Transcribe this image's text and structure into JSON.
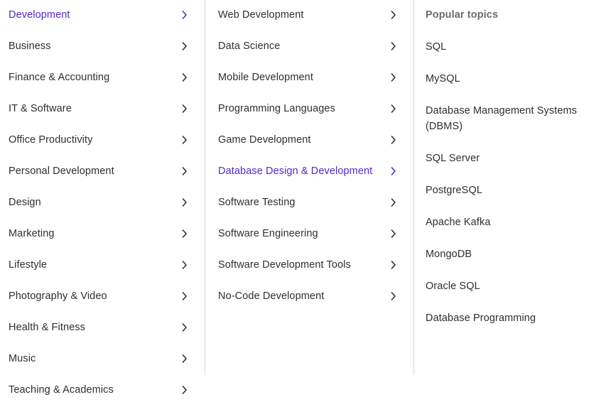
{
  "colors": {
    "accent": "#5624d0",
    "text": "#2d2f31",
    "muted": "#6a6f73",
    "divider": "#d1d7dc",
    "background": "#ffffff"
  },
  "categories": {
    "items": [
      {
        "label": "Development",
        "active": true,
        "chevron": "chevron-right-icon"
      },
      {
        "label": "Business",
        "active": false,
        "chevron": "chevron-right-icon"
      },
      {
        "label": "Finance & Accounting",
        "active": false,
        "chevron": "chevron-right-icon"
      },
      {
        "label": "IT & Software",
        "active": false,
        "chevron": "chevron-right-icon"
      },
      {
        "label": "Office Productivity",
        "active": false,
        "chevron": "chevron-right-icon"
      },
      {
        "label": "Personal Development",
        "active": false,
        "chevron": "chevron-right-icon"
      },
      {
        "label": "Design",
        "active": false,
        "chevron": "chevron-right-icon"
      },
      {
        "label": "Marketing",
        "active": false,
        "chevron": "chevron-right-icon"
      },
      {
        "label": "Lifestyle",
        "active": false,
        "chevron": "chevron-right-icon"
      },
      {
        "label": "Photography & Video",
        "active": false,
        "chevron": "chevron-right-icon"
      },
      {
        "label": "Health & Fitness",
        "active": false,
        "chevron": "chevron-right-icon"
      },
      {
        "label": "Music",
        "active": false,
        "chevron": "chevron-right-icon"
      },
      {
        "label": "Teaching & Academics",
        "active": false,
        "chevron": "chevron-right-icon"
      }
    ]
  },
  "subcategories": {
    "items": [
      {
        "label": "Web Development",
        "active": false,
        "chevron": "chevron-right-icon"
      },
      {
        "label": "Data Science",
        "active": false,
        "chevron": "chevron-right-icon"
      },
      {
        "label": "Mobile Development",
        "active": false,
        "chevron": "chevron-right-icon"
      },
      {
        "label": "Programming Languages",
        "active": false,
        "chevron": "chevron-right-icon"
      },
      {
        "label": "Game Development",
        "active": false,
        "chevron": "chevron-right-icon"
      },
      {
        "label": "Database Design & Development",
        "active": true,
        "chevron": "chevron-right-icon"
      },
      {
        "label": "Software Testing",
        "active": false,
        "chevron": "chevron-right-icon"
      },
      {
        "label": "Software Engineering",
        "active": false,
        "chevron": "chevron-right-icon"
      },
      {
        "label": "Software Development Tools",
        "active": false,
        "chevron": "chevron-right-icon"
      },
      {
        "label": "No-Code Development",
        "active": false,
        "chevron": "chevron-right-icon"
      }
    ]
  },
  "topics": {
    "heading": "Popular topics",
    "items": [
      {
        "label": "SQL"
      },
      {
        "label": "MySQL"
      },
      {
        "label": "Database Management Systems (DBMS)"
      },
      {
        "label": "SQL Server"
      },
      {
        "label": "PostgreSQL"
      },
      {
        "label": "Apache Kafka"
      },
      {
        "label": "MongoDB"
      },
      {
        "label": "Oracle SQL"
      },
      {
        "label": "Database Programming"
      }
    ]
  }
}
